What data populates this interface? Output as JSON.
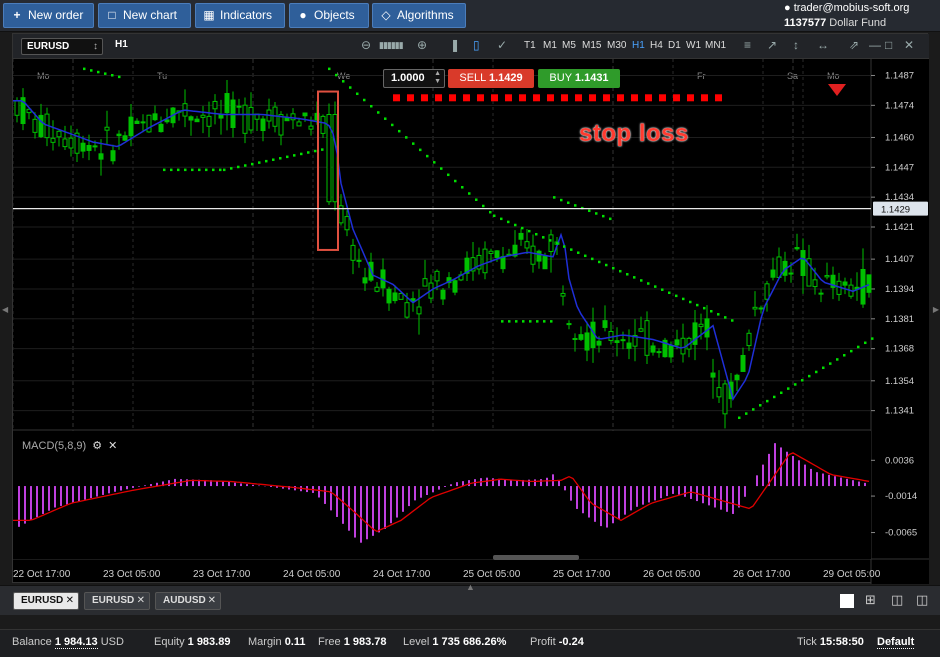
{
  "toolbar": {
    "new_order": "New order",
    "new_chart": "New chart",
    "indicators": "Indicators",
    "objects": "Objects",
    "algorithms": "Algorithms"
  },
  "account": {
    "user": "trader@mobius-soft.org",
    "id": "1137577",
    "fund": "Dollar Fund"
  },
  "chart": {
    "symbol": "EURUSD",
    "timeframe_label": "H1",
    "timeframes": [
      "T1",
      "M1",
      "M5",
      "M15",
      "M30",
      "H1",
      "H4",
      "D1",
      "W1",
      "MN1"
    ],
    "active_timeframe": "H1",
    "quantity": "1.0000",
    "sell_label": "SELL",
    "sell_price": "1.1429",
    "buy_label": "BUY",
    "buy_price": "1.1431",
    "annotation": "stop loss",
    "current_price": "1.1429",
    "day_labels": [
      "Mo",
      "Tu",
      "We",
      "Th",
      "Fr",
      "Sa",
      "Mo"
    ],
    "price_ticks": [
      "1.1487",
      "1.1474",
      "1.1460",
      "1.1447",
      "1.1434",
      "1.1421",
      "1.1407",
      "1.1394",
      "1.1381",
      "1.1368",
      "1.1354",
      "1.1341"
    ],
    "macd_label": "MACD(5,8,9)",
    "macd_ticks": [
      "0.0036",
      "-0.0014",
      "-0.0065"
    ],
    "time_labels": [
      "22 Oct 17:00",
      "23 Oct 05:00",
      "23 Oct 17:00",
      "24 Oct 05:00",
      "24 Oct 17:00",
      "25 Oct 05:00",
      "25 Oct 17:00",
      "26 Oct 05:00",
      "26 Oct 17:00",
      "29 Oct 05:00"
    ],
    "colors": {
      "bull": "#00c000",
      "sma": "#1f2fd8",
      "sar": "#00e000",
      "stop": "#ff0000",
      "macd_hist": "#c040e0",
      "macd_signal": "#e00000",
      "highlight": "#e05040"
    }
  },
  "tabs": [
    "EURUSD",
    "EURUSD",
    "AUDUSD"
  ],
  "status": {
    "balance_label": "Balance",
    "balance": "1 984.13",
    "currency": "USD",
    "equity_label": "Equity",
    "equity": "1 983.89",
    "margin_label": "Margin",
    "margin": "0.11",
    "free_label": "Free",
    "free": "1 983.78",
    "level_label": "Level",
    "level": "1 735 686.26%",
    "profit_label": "Profit",
    "profit": "-0.24",
    "tick_label": "Tick",
    "tick": "15:58:50",
    "default_label": "Default"
  }
}
